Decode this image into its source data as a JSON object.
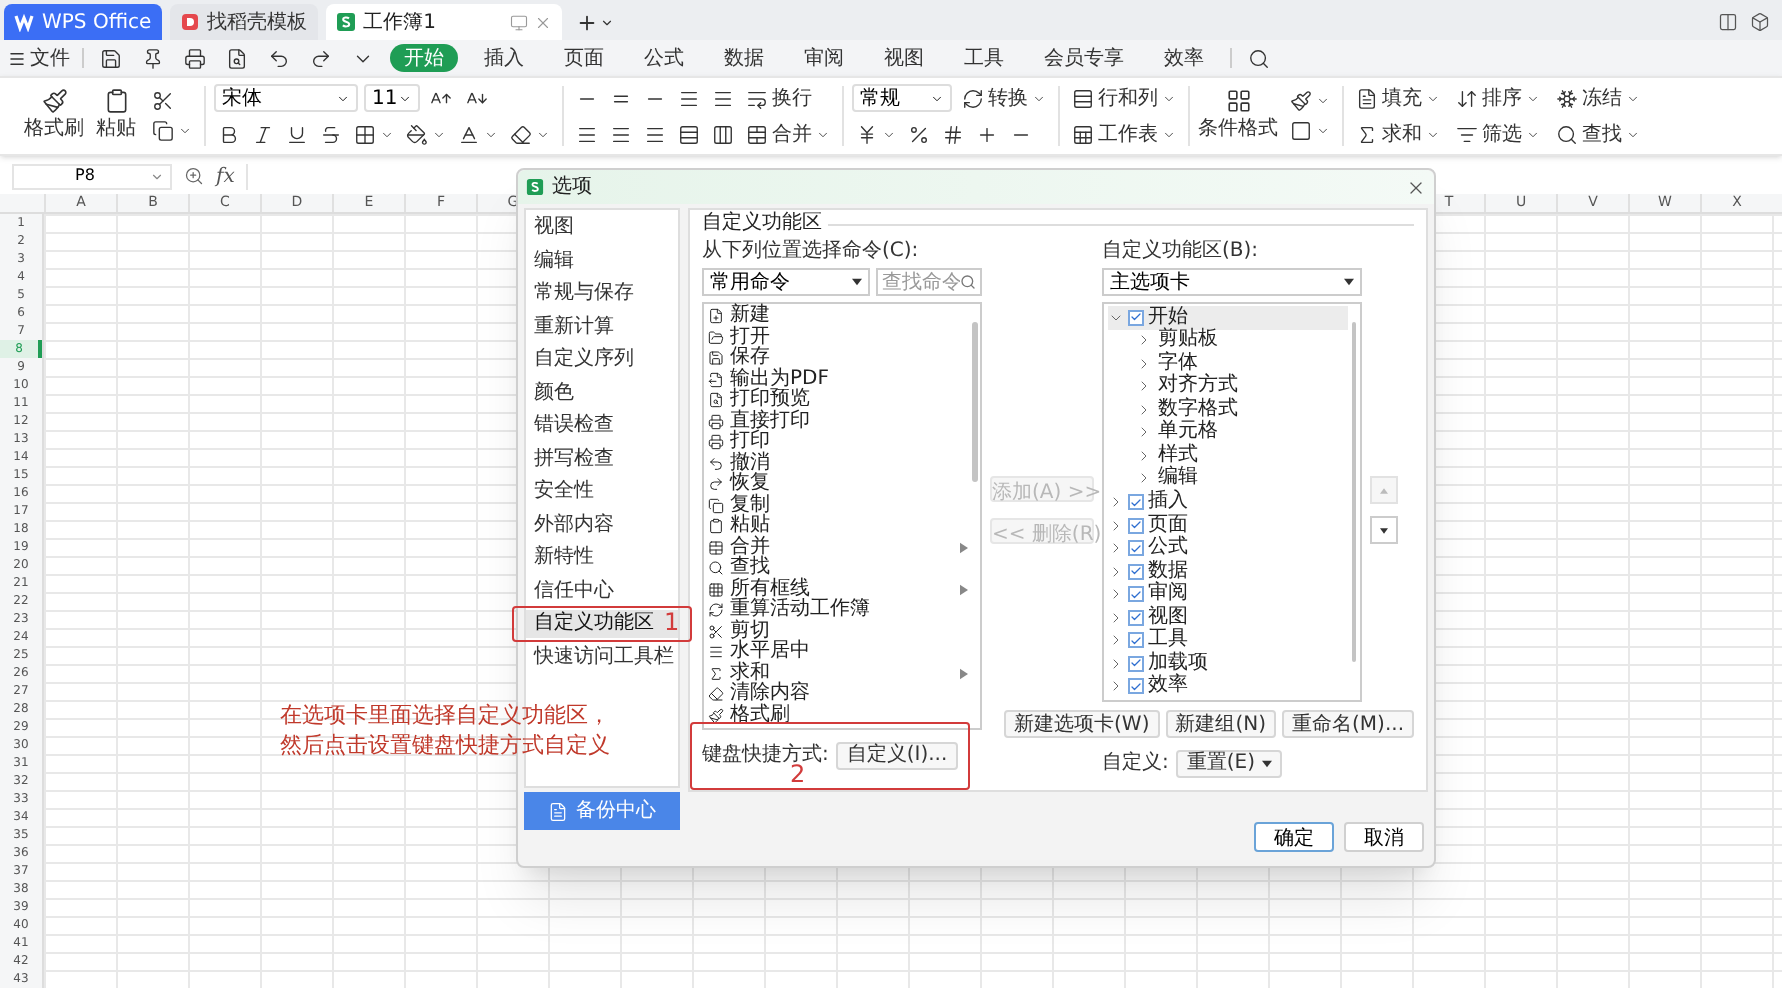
{
  "title_tabs": [
    {
      "kind": "home",
      "label": "WPS Office",
      "selected": false
    },
    {
      "kind": "template",
      "label": "找稻壳模板",
      "selected": false
    },
    {
      "kind": "sheet",
      "label": "工作簿1",
      "selected": true
    }
  ],
  "menu": {
    "file": "文件",
    "tabs": [
      {
        "label": "开始",
        "selected": true
      },
      {
        "label": "插入",
        "selected": false
      },
      {
        "label": "页面",
        "selected": false
      },
      {
        "label": "公式",
        "selected": false
      },
      {
        "label": "数据",
        "selected": false
      },
      {
        "label": "审阅",
        "selected": false
      },
      {
        "label": "视图",
        "selected": false
      },
      {
        "label": "工具",
        "selected": false
      },
      {
        "label": "会员专享",
        "selected": false
      },
      {
        "label": "效率",
        "selected": false
      }
    ]
  },
  "ribbon": {
    "format_painter": "格式刷",
    "paste": "粘贴",
    "font": "宋体",
    "size": "11",
    "wrap": "换行",
    "merge": "合并",
    "number_format": "常规",
    "convert": "转换",
    "rows_cols": "行和列",
    "worksheet": "工作表",
    "conditional": "条件格式",
    "fill": "填充",
    "sort": "排序",
    "freeze": "冻结",
    "sum": "求和",
    "filter": "筛选",
    "find": "查找"
  },
  "formula_bar": {
    "name_box": "P8",
    "fx": "fx"
  },
  "sheet": {
    "columns_left": [
      "A",
      "B",
      "C",
      "D",
      "E",
      "F",
      "G"
    ],
    "columns_right": [
      "T",
      "U",
      "V",
      "W",
      "X"
    ],
    "rows": [
      {
        "label": "1",
        "selected": false
      },
      {
        "label": "2",
        "selected": false
      },
      {
        "label": "3",
        "selected": false
      },
      {
        "label": "4",
        "selected": false
      },
      {
        "label": "5",
        "selected": false
      },
      {
        "label": "6",
        "selected": false
      },
      {
        "label": "7",
        "selected": false
      },
      {
        "label": "8",
        "selected": true
      },
      {
        "label": "9",
        "selected": false
      },
      {
        "label": "10",
        "selected": false
      },
      {
        "label": "11",
        "selected": false
      },
      {
        "label": "12",
        "selected": false
      },
      {
        "label": "13",
        "selected": false
      },
      {
        "label": "14",
        "selected": false
      },
      {
        "label": "15",
        "selected": false
      },
      {
        "label": "16",
        "selected": false
      },
      {
        "label": "17",
        "selected": false
      },
      {
        "label": "18",
        "selected": false
      },
      {
        "label": "19",
        "selected": false
      },
      {
        "label": "20",
        "selected": false
      },
      {
        "label": "21",
        "selected": false
      },
      {
        "label": "22",
        "selected": false
      },
      {
        "label": "23",
        "selected": false
      },
      {
        "label": "24",
        "selected": false
      },
      {
        "label": "25",
        "selected": false
      },
      {
        "label": "26",
        "selected": false
      },
      {
        "label": "27",
        "selected": false
      },
      {
        "label": "28",
        "selected": false
      },
      {
        "label": "29",
        "selected": false
      },
      {
        "label": "30",
        "selected": false
      },
      {
        "label": "31",
        "selected": false
      },
      {
        "label": "32",
        "selected": false
      },
      {
        "label": "33",
        "selected": false
      },
      {
        "label": "34",
        "selected": false
      },
      {
        "label": "35",
        "selected": false
      },
      {
        "label": "36",
        "selected": false
      },
      {
        "label": "37",
        "selected": false
      },
      {
        "label": "38",
        "selected": false
      },
      {
        "label": "39",
        "selected": false
      },
      {
        "label": "40",
        "selected": false
      },
      {
        "label": "41",
        "selected": false
      },
      {
        "label": "42",
        "selected": false
      },
      {
        "label": "43",
        "selected": false
      }
    ]
  },
  "dialog": {
    "title": "选项",
    "nav": [
      {
        "label": "视图",
        "selected": false
      },
      {
        "label": "编辑",
        "selected": false
      },
      {
        "label": "常规与保存",
        "selected": false
      },
      {
        "label": "重新计算",
        "selected": false
      },
      {
        "label": "自定义序列",
        "selected": false
      },
      {
        "label": "颜色",
        "selected": false
      },
      {
        "label": "错误检查",
        "selected": false
      },
      {
        "label": "拼写检查",
        "selected": false
      },
      {
        "label": "安全性",
        "selected": false
      },
      {
        "label": "外部内容",
        "selected": false
      },
      {
        "label": "新特性",
        "selected": false
      },
      {
        "label": "信任中心",
        "selected": false
      },
      {
        "label": "自定义功能区",
        "selected": true
      },
      {
        "label": "快速访问工具栏",
        "selected": false
      }
    ],
    "backup": "备份中心",
    "section": "自定义功能区",
    "source_label": "从下列位置选择命令(C):",
    "source": "常用命令",
    "search_placeholder": "查找命令",
    "commands": [
      {
        "label": "新建",
        "submenu": false
      },
      {
        "label": "打开",
        "submenu": false
      },
      {
        "label": "保存",
        "submenu": false
      },
      {
        "label": "输出为PDF",
        "submenu": false
      },
      {
        "label": "打印预览",
        "submenu": false
      },
      {
        "label": "直接打印",
        "submenu": false
      },
      {
        "label": "打印",
        "submenu": false
      },
      {
        "label": "撤消",
        "submenu": false
      },
      {
        "label": "恢复",
        "submenu": false
      },
      {
        "label": "复制",
        "submenu": false
      },
      {
        "label": "粘贴",
        "submenu": false
      },
      {
        "label": "合并",
        "submenu": true
      },
      {
        "label": "查找",
        "submenu": false
      },
      {
        "label": "所有框线",
        "submenu": true
      },
      {
        "label": "重算活动工作簿",
        "submenu": false
      },
      {
        "label": "剪切",
        "submenu": false
      },
      {
        "label": "水平居中",
        "submenu": false
      },
      {
        "label": "求和",
        "submenu": true
      },
      {
        "label": "清除内容",
        "submenu": false
      },
      {
        "label": "格式刷",
        "submenu": false
      }
    ],
    "add": {
      "label": "添加(A) >>",
      "disabled": true
    },
    "remove": {
      "label": "<< 删除(R)",
      "disabled": true
    },
    "target_label": "自定义功能区(B):",
    "target": "主选项卡",
    "tree": [
      {
        "label": "开始",
        "checked": true,
        "expanded": true,
        "selected": true,
        "children": [
          {
            "label": "剪贴板",
            "expanded": false,
            "selected": false
          },
          {
            "label": "字体",
            "expanded": false,
            "selected": false
          },
          {
            "label": "对齐方式",
            "expanded": false,
            "selected": false
          },
          {
            "label": "数字格式",
            "expanded": false,
            "selected": false
          },
          {
            "label": "单元格",
            "expanded": false,
            "selected": false
          },
          {
            "label": "样式",
            "expanded": false,
            "selected": false
          },
          {
            "label": "编辑",
            "expanded": false,
            "selected": false
          }
        ]
      },
      {
        "label": "插入",
        "checked": true,
        "expanded": false,
        "selected": false
      },
      {
        "label": "页面",
        "checked": true,
        "expanded": false,
        "selected": false
      },
      {
        "label": "公式",
        "checked": true,
        "expanded": false,
        "selected": false
      },
      {
        "label": "数据",
        "checked": true,
        "expanded": false,
        "selected": false
      },
      {
        "label": "审阅",
        "checked": true,
        "expanded": false,
        "selected": false
      },
      {
        "label": "视图",
        "checked": true,
        "expanded": false,
        "selected": false
      },
      {
        "label": "工具",
        "checked": true,
        "expanded": false,
        "selected": false
      },
      {
        "label": "加载项",
        "checked": true,
        "expanded": false,
        "selected": false
      },
      {
        "label": "效率",
        "checked": true,
        "expanded": false,
        "selected": false
      }
    ],
    "tree_buttons": [
      "新建选项卡(W)",
      "新建组(N)",
      "重命名(M)..."
    ],
    "customize_label": "自定义:",
    "reset": "重置(E)",
    "shortcut_label": "键盘快捷方式:",
    "shortcut_button": "自定义(I)...",
    "ok": "确定",
    "cancel": "取消"
  },
  "annotations": {
    "note": "在选项卡里面选择自定义功能区，然后点击设置键盘快捷方式自定义",
    "marker_1": "1",
    "marker_2": "2"
  }
}
